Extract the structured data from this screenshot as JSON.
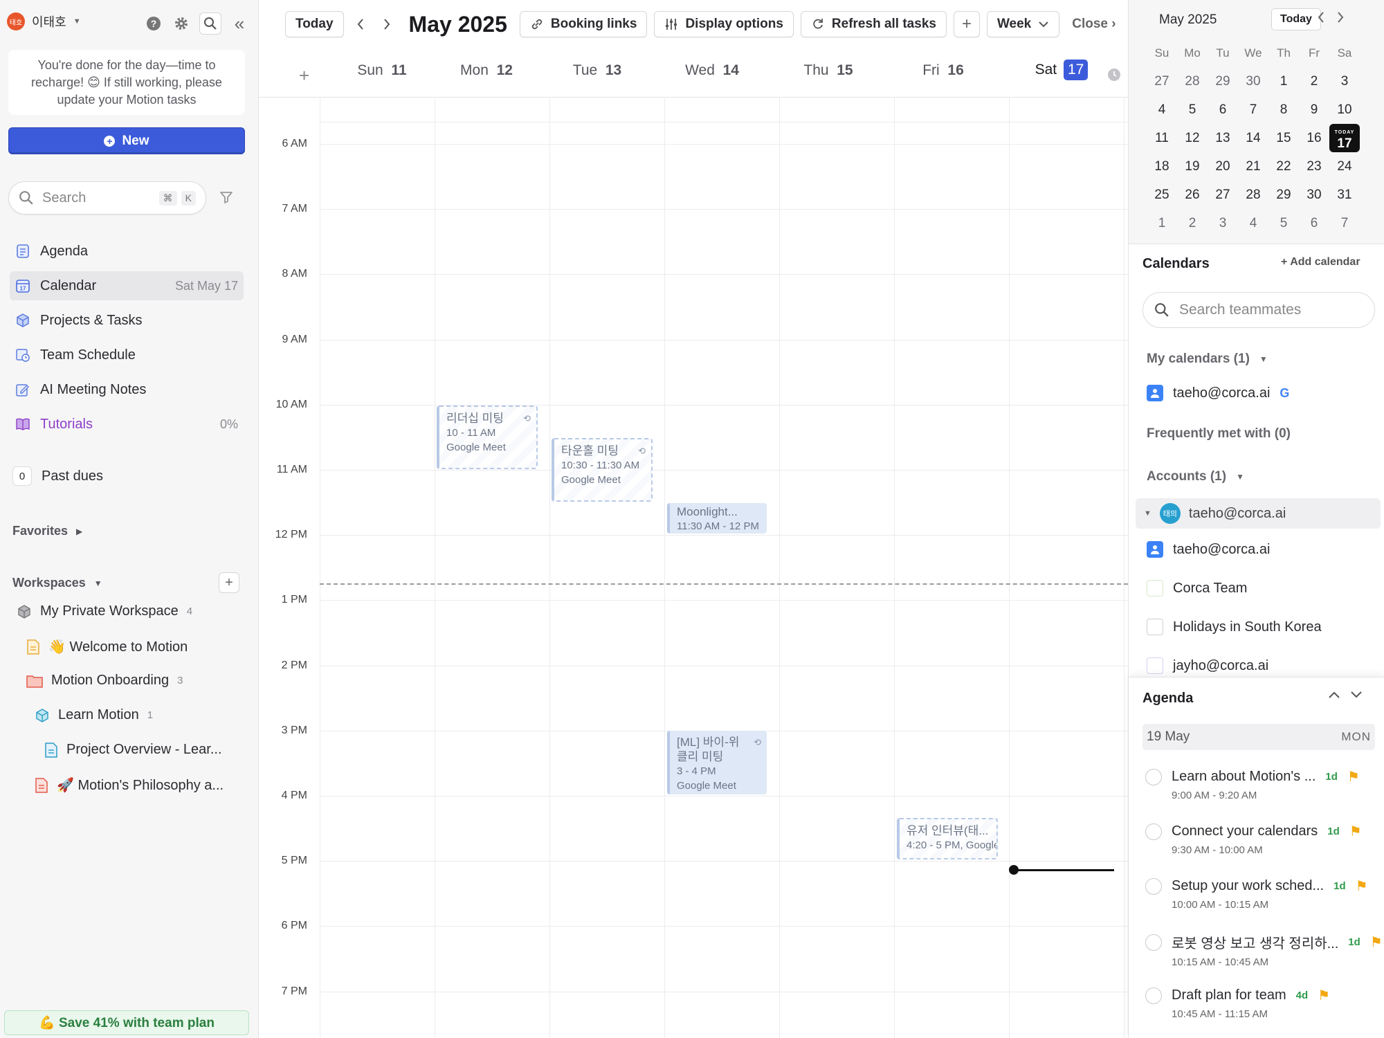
{
  "sidebar": {
    "user_name": "이태호",
    "avatar_text": "태호",
    "notice": "You're done for the day—time to recharge! 😊 If still working, please update your Motion tasks",
    "new_label": "New",
    "search_placeholder": "Search",
    "search_kbd": [
      "⌘",
      "K"
    ],
    "nav": [
      {
        "label": "Agenda",
        "icon": "agenda-icon",
        "meta": ""
      },
      {
        "label": "Calendar",
        "icon": "calendar-icon",
        "meta": "Sat May 17"
      },
      {
        "label": "Projects & Tasks",
        "icon": "cube-icon",
        "meta": ""
      },
      {
        "label": "Team Schedule",
        "icon": "team-schedule-icon",
        "meta": ""
      },
      {
        "label": "AI Meeting Notes",
        "icon": "notes-icon",
        "meta": ""
      },
      {
        "label": "Tutorials",
        "icon": "book-icon",
        "meta": "0%"
      }
    ],
    "past_dues_count": "0",
    "past_dues_label": "Past dues",
    "favorites_label": "Favorites",
    "workspaces_label": "Workspaces",
    "tree": [
      {
        "label": "My Private Workspace",
        "count": "4"
      },
      {
        "label": "👋 Welcome to Motion",
        "count": ""
      },
      {
        "label": "Motion Onboarding",
        "count": "3"
      },
      {
        "label": "Learn Motion",
        "count": "1"
      },
      {
        "label": "Project Overview - Lear...",
        "count": ""
      },
      {
        "label": "🚀 Motion's Philosophy a...",
        "count": ""
      }
    ],
    "promo": "💪 Save 41% with team plan"
  },
  "toolbar": {
    "today": "Today",
    "month": "May 2025",
    "booking": "Booking links",
    "display": "Display options",
    "refresh": "Refresh all tasks",
    "plus": "+",
    "view": "Week",
    "close": "Close"
  },
  "days": [
    {
      "dow": "Sun",
      "num": "11"
    },
    {
      "dow": "Mon",
      "num": "12"
    },
    {
      "dow": "Tue",
      "num": "13"
    },
    {
      "dow": "Wed",
      "num": "14"
    },
    {
      "dow": "Thu",
      "num": "15"
    },
    {
      "dow": "Fri",
      "num": "16"
    },
    {
      "dow": "Sat",
      "num": "17"
    }
  ],
  "times": [
    "6 AM",
    "7 AM",
    "8 AM",
    "9 AM",
    "10 AM",
    "11 AM",
    "12 PM",
    "1 PM",
    "2 PM",
    "3 PM",
    "4 PM",
    "5 PM",
    "6 PM",
    "7 PM"
  ],
  "events": [
    {
      "title": "리더십 미팅",
      "time": "10 - 11 AM",
      "place": "Google Meet"
    },
    {
      "title": "타운홀 미팅",
      "time": "10:30 - 11:30 AM",
      "place": "Google Meet"
    },
    {
      "title": "Moonlight...",
      "time": "11:30 AM - 12 PM",
      "place": ""
    },
    {
      "title": "[ML] 바이-위클리 미팅",
      "time": "3 - 4 PM",
      "place": "Google Meet"
    },
    {
      "title": "유저 인터뷰(태...",
      "time": "4:20 - 5 PM, Google Meet",
      "place": ""
    }
  ],
  "mini_cal": {
    "month": "May 2025",
    "today": "Today",
    "today_tag": "TODAY",
    "dow": [
      "Su",
      "Mo",
      "Tu",
      "We",
      "Th",
      "Fr",
      "Sa"
    ],
    "weeks": [
      [
        "27",
        "28",
        "29",
        "30",
        "1",
        "2",
        "3"
      ],
      [
        "4",
        "5",
        "6",
        "7",
        "8",
        "9",
        "10"
      ],
      [
        "11",
        "12",
        "13",
        "14",
        "15",
        "16",
        "17"
      ],
      [
        "18",
        "19",
        "20",
        "21",
        "22",
        "23",
        "24"
      ],
      [
        "25",
        "26",
        "27",
        "28",
        "29",
        "30",
        "31"
      ],
      [
        "1",
        "2",
        "3",
        "4",
        "5",
        "6",
        "7"
      ]
    ]
  },
  "calendars": {
    "title": "Calendars",
    "add": "+ Add calendar",
    "search_placeholder": "Search teammates",
    "my_calendars": "My calendars (1)",
    "my_email": "taeho@corca.ai",
    "frequently": "Frequently met with (0)",
    "accounts": "Accounts (1)",
    "account_avatar": "태의",
    "account_email": "taeho@corca.ai",
    "list": [
      "taeho@corca.ai",
      "Corca Team",
      "Holidays in South Korea",
      "jayho@corca.ai"
    ]
  },
  "agenda": {
    "title": "Agenda",
    "date": "19  May",
    "dow": "MON",
    "items": [
      {
        "title": "Learn about Motion's ...",
        "dur": "1d",
        "time": "9:00 AM - 9:20 AM"
      },
      {
        "title": "Connect your calendars",
        "dur": "1d",
        "time": "9:30 AM - 10:00 AM"
      },
      {
        "title": "Setup your work sched...",
        "dur": "1d",
        "time": "10:00 AM - 10:15 AM"
      },
      {
        "title": "로봇 영상 보고 생각 정리하...",
        "dur": "1d",
        "time": "10:15 AM - 10:45 AM"
      },
      {
        "title": "Draft plan for team",
        "dur": "4d",
        "time": "10:45 AM - 11:15 AM"
      }
    ]
  }
}
